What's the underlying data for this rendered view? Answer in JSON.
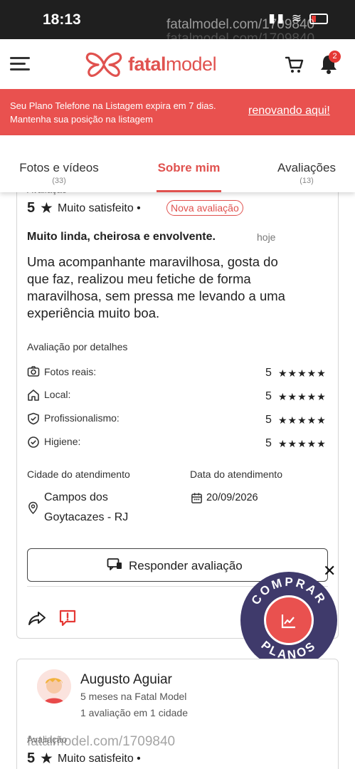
{
  "status_bar": {
    "time": "18:13",
    "watermark": "fatalmodel.com/1709840",
    "battery_level": 0.25
  },
  "header": {
    "brand_strong": "fatal",
    "brand_rest": "model",
    "notification_count": "2",
    "brand_color": "#e0524f"
  },
  "banner": {
    "line1": "Seu Plano Telefone na Listagem expira em 7 dias.",
    "line2": "Mantenha sua posição na listagem",
    "link": "renovando aqui!",
    "color": "#e9514f"
  },
  "tabs": [
    {
      "label": "Fotos e vídeos",
      "count": "(33)"
    },
    {
      "label": "Sobre mim",
      "count": ""
    },
    {
      "label": "Avaliações",
      "count": "(13)"
    }
  ],
  "review": {
    "cut_label": "Avaliação",
    "score": "5",
    "star": "★",
    "rating_text": "Muito satisfeito •",
    "new_badge": "Nova avaliação",
    "title": "Muito linda, cheirosa e envolvente.",
    "when": "hoje",
    "body": [
      "Uma acompanhante maravilhosa, gosta do",
      "que faz, realizou meu fetiche de forma",
      "maravilhosa, sem pressa me levando a uma",
      "experiência muito boa."
    ],
    "details_title": "Avaliação por detalhes",
    "details": [
      {
        "label": "Fotos reais:",
        "score": "5",
        "stars": "★★★★★",
        "icon": "camera-icon"
      },
      {
        "label": "Local:",
        "score": "5",
        "stars": "★★★★★",
        "icon": "home-icon"
      },
      {
        "label": "Profissionalismo:",
        "score": "5",
        "stars": "★★★★★",
        "icon": "shield-check-icon"
      },
      {
        "label": "Higiene:",
        "score": "5",
        "stars": "★★★★★",
        "icon": "check-circle-icon"
      }
    ],
    "city_label": "Cidade do atendimento",
    "city_line1": "Campos dos",
    "city_line2": "Goytacazes - RJ",
    "date_label": "Data do atendimento",
    "date": "20/09/2026",
    "reply_button": "Responder avaliação"
  },
  "fab": {
    "top_text": "COMPRAR",
    "bottom_text": "PLANOS",
    "color": "#3f3a6b"
  },
  "next_review": {
    "name": "Augusto Aguiar",
    "meta1": "5 meses na Fatal Model",
    "meta2": "1 avaliação em 1 cidade",
    "cut_label": "Avaliação",
    "score": "5",
    "star": "★",
    "rating_text": "Muito satisfeito •"
  }
}
